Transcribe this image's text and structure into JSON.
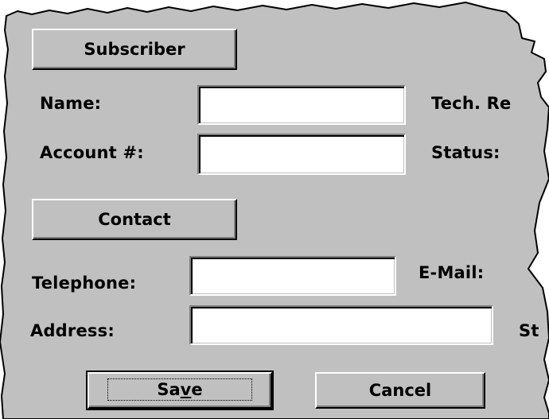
{
  "colors": {
    "panel": "#c0c0c0",
    "background": "#ffffff",
    "text": "#000000"
  },
  "subscriber": {
    "section_button": "Subscriber",
    "name_label": "Name:",
    "name_value": "",
    "account_label": "Account #:",
    "account_value": "",
    "tech_rep_label_partial": "Tech. Re",
    "status_label": "Status:"
  },
  "contact": {
    "section_button": "Contact",
    "telephone_label": "Telephone:",
    "telephone_value": "",
    "email_label": "E-Mail:",
    "address_label": "Address:",
    "address_value": "",
    "state_label_partial": "St"
  },
  "actions": {
    "save_label": "Save",
    "save_mnemonic_index": 2,
    "cancel_label": "Cancel"
  }
}
